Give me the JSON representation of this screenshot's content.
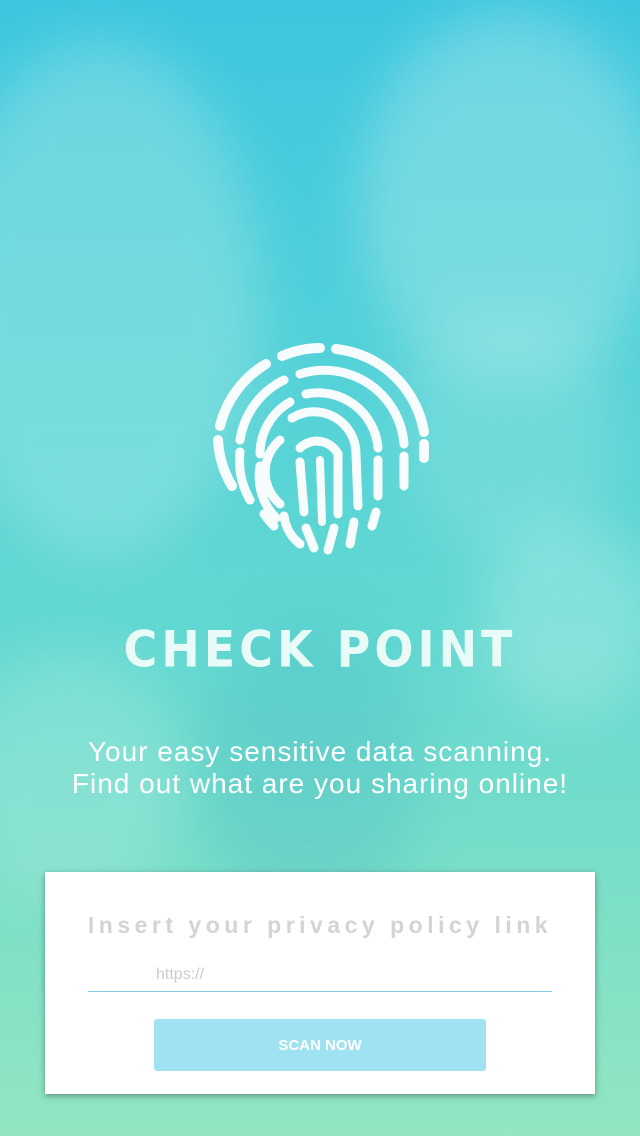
{
  "brand": {
    "title": "CHECK POINT",
    "logo_icon": "fingerprint-icon"
  },
  "tagline": {
    "line1": "Your easy sensitive data scanning.",
    "line2": "Find out what are you sharing online!"
  },
  "form": {
    "label": "Insert your privacy policy link",
    "input_placeholder": "https://",
    "input_value": "",
    "submit_label": "SCAN NOW"
  },
  "colors": {
    "background_top": "#3cc6df",
    "background_bottom": "#92e6c2",
    "button": "#9fe2f1",
    "input_underline": "#7ecfe2"
  }
}
